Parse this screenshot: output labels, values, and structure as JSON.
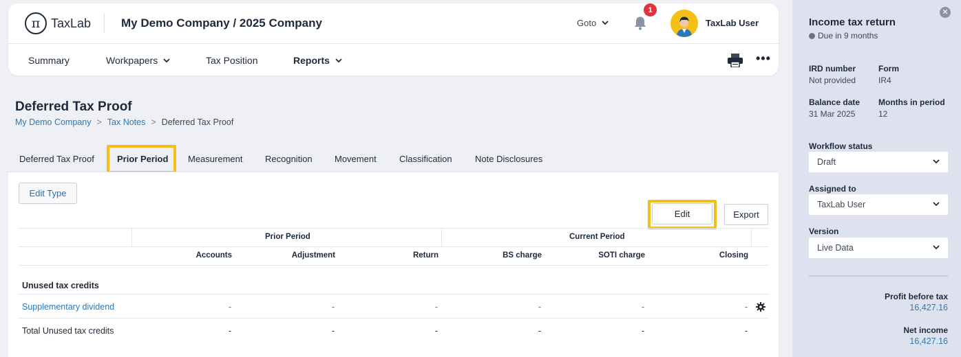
{
  "header": {
    "logo_text": "TaxLab",
    "logo_symbol": "π",
    "company": "My Demo Company / 2025 Company",
    "goto_label": "Goto",
    "notification_count": "1",
    "user_name": "TaxLab User"
  },
  "nav": {
    "summary": "Summary",
    "workpapers": "Workpapers",
    "tax_position": "Tax Position",
    "reports": "Reports"
  },
  "page": {
    "title": "Deferred Tax Proof",
    "breadcrumb": [
      "My Demo Company",
      "Tax Notes",
      "Deferred Tax Proof"
    ]
  },
  "tabs": [
    "Deferred Tax Proof",
    "Prior Period",
    "Measurement",
    "Recognition",
    "Movement",
    "Classification",
    "Note Disclosures"
  ],
  "toolbar": {
    "edit_type": "Edit Type",
    "edit": "Edit",
    "export": "Export"
  },
  "table": {
    "group_headers": [
      "Prior Period",
      "Current Period"
    ],
    "columns": [
      "Accounts",
      "Adjustment",
      "Return",
      "BS charge",
      "SOTI charge",
      "Closing"
    ],
    "section_title": "Unused tax credits",
    "rows": [
      {
        "label": "Supplementary dividend",
        "values": [
          "-",
          "-",
          "-",
          "-",
          "-",
          "-"
        ]
      },
      {
        "label": "Total Unused tax credits",
        "values": [
          "-",
          "-",
          "-",
          "-",
          "-",
          "-"
        ]
      }
    ]
  },
  "sidebar": {
    "title": "Income tax return",
    "due": "Due in 9 months",
    "ird_label": "IRD number",
    "ird_value": "Not provided",
    "form_label": "Form",
    "form_value": "IR4",
    "balance_label": "Balance date",
    "balance_value": "31 Mar 2025",
    "months_label": "Months in period",
    "months_value": "12",
    "workflow_label": "Workflow status",
    "workflow_value": "Draft",
    "assigned_label": "Assigned to",
    "assigned_value": "TaxLab User",
    "version_label": "Version",
    "version_value": "Live Data",
    "profit_label": "Profit before tax",
    "profit_value": "16,427.16",
    "net_income_label": "Net income",
    "net_income_value": "16,427.16"
  },
  "colors": {
    "accent_link": "#2a7ab8",
    "highlight": "#f4c018",
    "badge": "#e2323a",
    "sidebar_bg": "#dde2ee"
  }
}
